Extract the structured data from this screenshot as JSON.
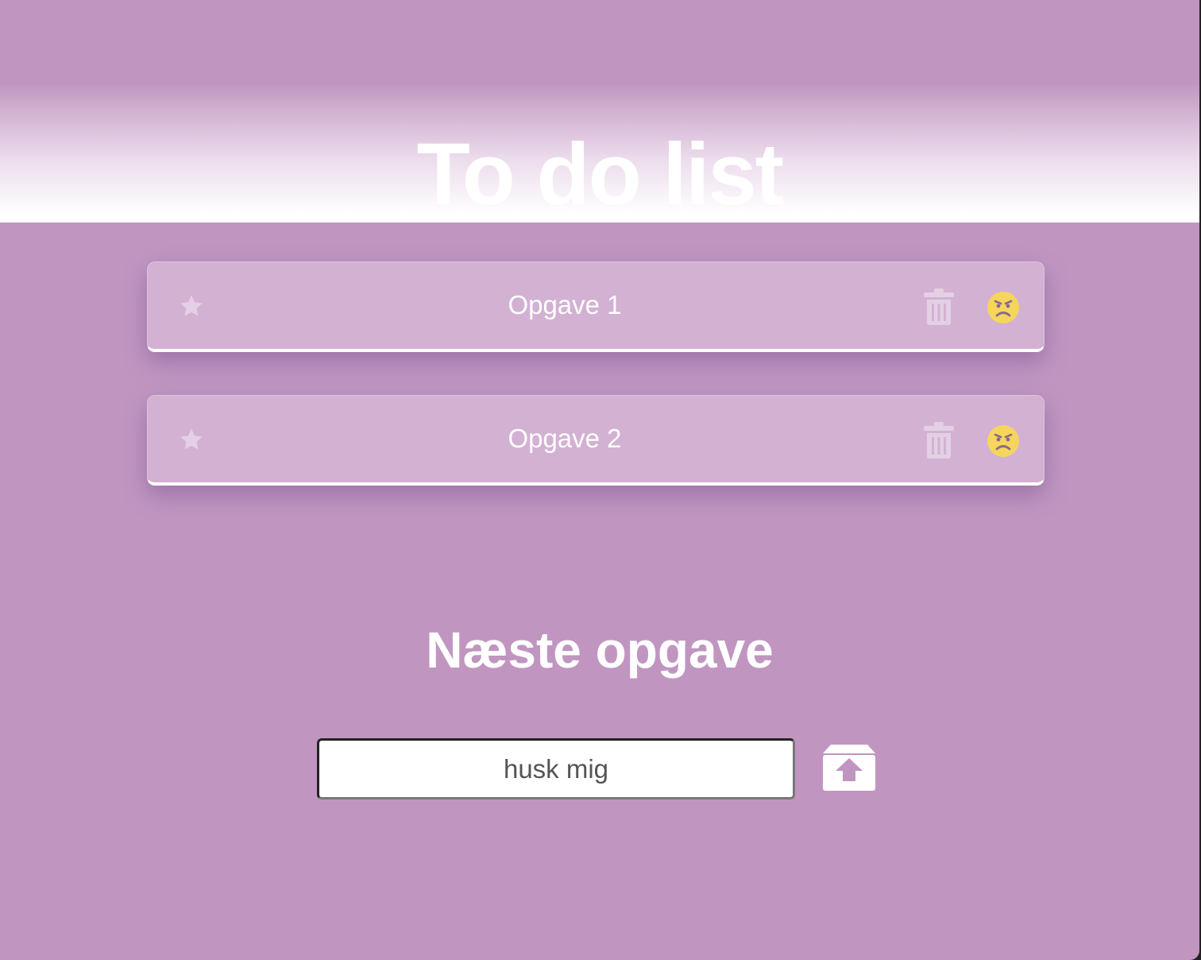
{
  "header": {
    "title": "To do list"
  },
  "tasks": [
    {
      "label": "Opgave 1",
      "starred": false,
      "mood": "angry"
    },
    {
      "label": "Opgave 2",
      "starred": false,
      "mood": "angry"
    }
  ],
  "new_task": {
    "heading": "Næste opgave",
    "input_value": "husk mig",
    "submit_icon": "upload-box-icon"
  },
  "icons": {
    "star": "star-icon",
    "delete": "trash-icon",
    "mood": "angry-face-icon"
  },
  "colors": {
    "background": "#c096c1",
    "card": "#d3b1d3",
    "text": "#ffffff",
    "icon_muted": "#e4d0e4",
    "mood_face": "#f6d55c"
  }
}
